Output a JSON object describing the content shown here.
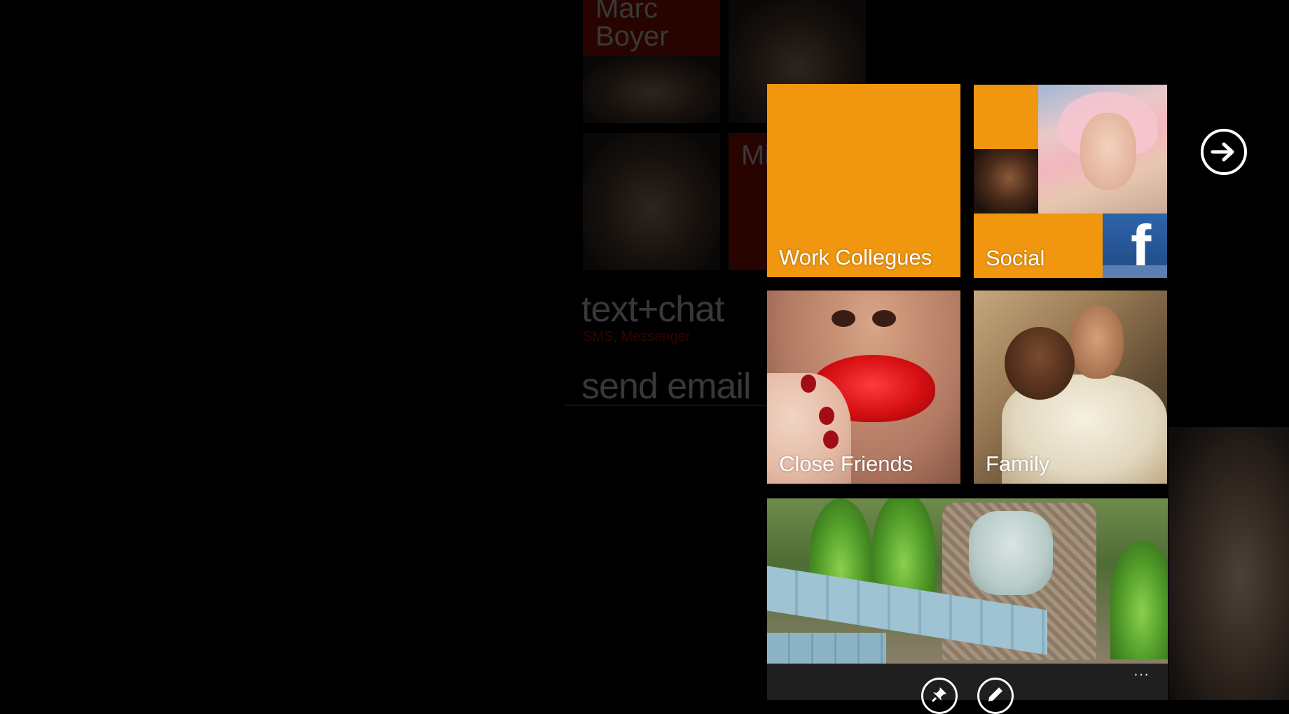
{
  "background": {
    "contact_name": "Marc Boyer",
    "partial_tile_text": "Mi",
    "actions": [
      {
        "label": "text+chat",
        "sub": "SMS, Messenger"
      },
      {
        "label": "send email",
        "sub": ""
      }
    ]
  },
  "tiles": {
    "work": {
      "label": "Work Collegues"
    },
    "social": {
      "label": "Social",
      "facebook_glyph": "f"
    },
    "close": {
      "label": "Close Friends"
    },
    "family": {
      "label": "Family"
    }
  },
  "navigation": {
    "next_icon": "arrow-right-circle-icon"
  },
  "appbar": {
    "buttons": [
      {
        "icon": "pin-icon"
      },
      {
        "icon": "edit-icon"
      }
    ],
    "more": "..."
  },
  "colors": {
    "accent": "#f0960f",
    "red_accent": "#b21400",
    "facebook_blue": "#2f63a8",
    "appbar": "#1f1f1f"
  }
}
